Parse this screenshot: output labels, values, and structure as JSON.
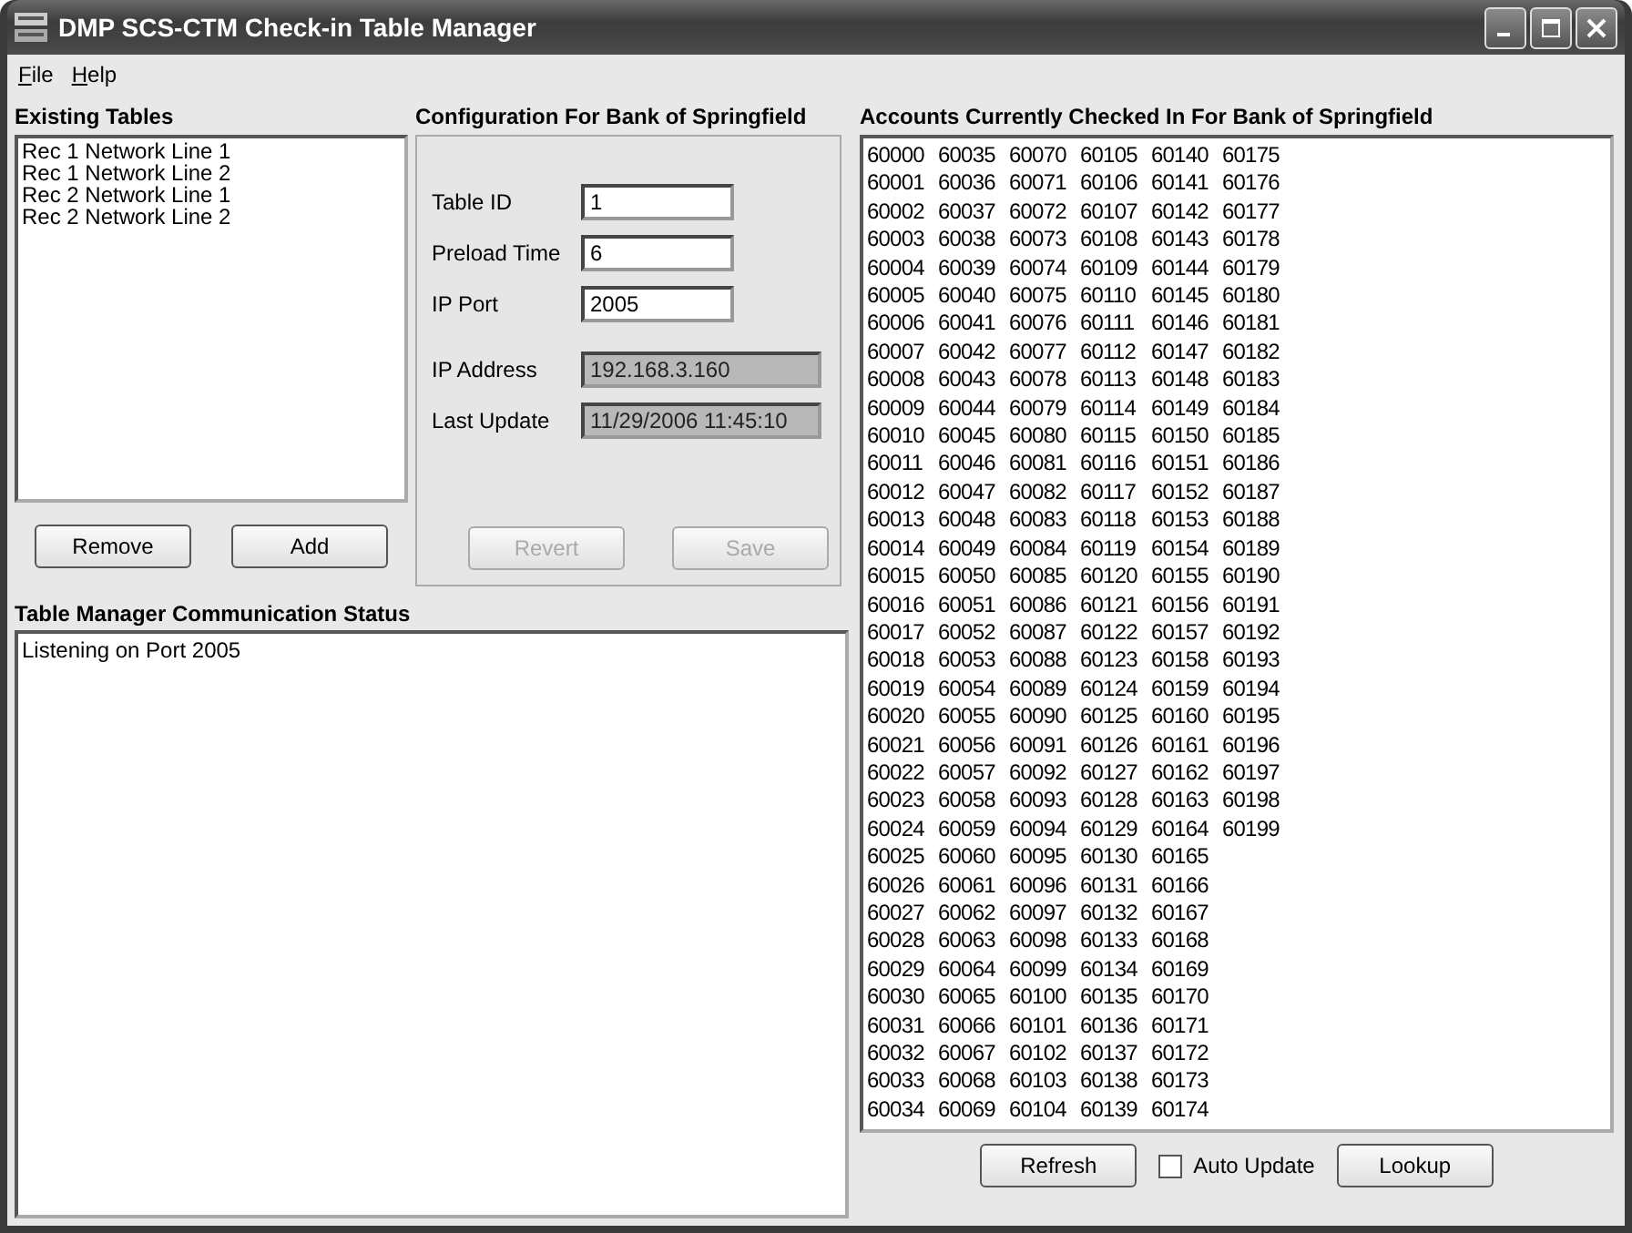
{
  "window": {
    "title": "DMP SCS-CTM Check-in Table Manager"
  },
  "menu": [
    "File",
    "Help"
  ],
  "existing_tables": {
    "heading": "Existing Tables",
    "items": [
      {
        "label": "Rec 1 Network Line 1",
        "selected": false
      },
      {
        "label": "Rec 1 Network Line 2",
        "selected": false
      },
      {
        "label": "Rec 2 Network Line 1",
        "selected": false
      },
      {
        "label": "Rec 2 Network Line 2",
        "selected": false
      }
    ],
    "buttons": [
      "Remove",
      "Add"
    ]
  },
  "configuration": {
    "heading": "Configuration For Bank of Springfield",
    "fields": [
      {
        "label": "Table ID",
        "value": "1",
        "disabled": false
      },
      {
        "label": "Preload Time",
        "value": "6",
        "disabled": false
      },
      {
        "label": "IP Port",
        "value": "2005",
        "disabled": false
      },
      {
        "label": "IP Address",
        "value": "192.168.3.160",
        "disabled": true
      },
      {
        "label": "Last Update",
        "value": "11/29/2006 11:45:10",
        "disabled": true
      }
    ],
    "buttons": [
      {
        "label": "Revert",
        "disabled": true
      },
      {
        "label": "Save",
        "disabled": true
      }
    ]
  },
  "status": {
    "heading": "Table Manager Communication Status",
    "lines": [
      "Listening on Port 2005"
    ]
  },
  "accounts": {
    "heading": "Accounts Currently Checked In For Bank of Springfield",
    "columns": [
      [
        "60000",
        "60001",
        "60002",
        "60003",
        "60004",
        "60005",
        "60006",
        "60007",
        "60008",
        "60009",
        "60010",
        "60011",
        "60012",
        "60013",
        "60014",
        "60015",
        "60016",
        "60017",
        "60018",
        "60019",
        "60020",
        "60021",
        "60022",
        "60023",
        "60024",
        "60025",
        "60026",
        "60027",
        "60028",
        "60029",
        "60030",
        "60031",
        "60032",
        "60033",
        "60034"
      ],
      [
        "60035",
        "60036",
        "60037",
        "60038",
        "60039",
        "60040",
        "60041",
        "60042",
        "60043",
        "60044",
        "60045",
        "60046",
        "60047",
        "60048",
        "60049",
        "60050",
        "60051",
        "60052",
        "60053",
        "60054",
        "60055",
        "60056",
        "60057",
        "60058",
        "60059",
        "60060",
        "60061",
        "60062",
        "60063",
        "60064",
        "60065",
        "60066",
        "60067",
        "60068",
        "60069"
      ],
      [
        "60070",
        "60071",
        "60072",
        "60073",
        "60074",
        "60075",
        "60076",
        "60077",
        "60078",
        "60079",
        "60080",
        "60081",
        "60082",
        "60083",
        "60084",
        "60085",
        "60086",
        "60087",
        "60088",
        "60089",
        "60090",
        "60091",
        "60092",
        "60093",
        "60094",
        "60095",
        "60096",
        "60097",
        "60098",
        "60099",
        "60100",
        "60101",
        "60102",
        "60103",
        "60104"
      ],
      [
        "60105",
        "60106",
        "60107",
        "60108",
        "60109",
        "60110",
        "60111",
        "60112",
        "60113",
        "60114",
        "60115",
        "60116",
        "60117",
        "60118",
        "60119",
        "60120",
        "60121",
        "60122",
        "60123",
        "60124",
        "60125",
        "60126",
        "60127",
        "60128",
        "60129",
        "60130",
        "60131",
        "60132",
        "60133",
        "60134",
        "60135",
        "60136",
        "60137",
        "60138",
        "60139"
      ],
      [
        "60140",
        "60141",
        "60142",
        "60143",
        "60144",
        "60145",
        "60146",
        "60147",
        "60148",
        "60149",
        "60150",
        "60151",
        "60152",
        "60153",
        "60154",
        "60155",
        "60156",
        "60157",
        "60158",
        "60159",
        "60160",
        "60161",
        "60162",
        "60163",
        "60164",
        "60165",
        "60166",
        "60167",
        "60168",
        "60169",
        "60170",
        "60171",
        "60172",
        "60173",
        "60174"
      ],
      [
        "60175",
        "60176",
        "60177",
        "60178",
        "60179",
        "60180",
        "60181",
        "60182",
        "60183",
        "60184",
        "60185",
        "60186",
        "60187",
        "60188",
        "60189",
        "60190",
        "60191",
        "60192",
        "60193",
        "60194",
        "60195",
        "60196",
        "60197",
        "60198",
        "60199"
      ]
    ],
    "refresh_button": "Refresh",
    "auto_update": {
      "label": "Auto Update",
      "checked": false
    },
    "lookup_button": "Lookup"
  }
}
